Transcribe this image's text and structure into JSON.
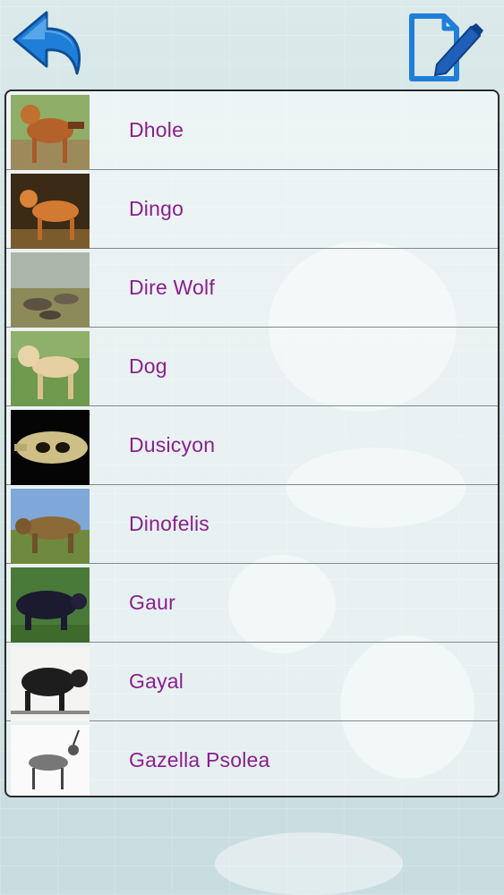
{
  "header": {
    "back_icon": "back-arrow-icon",
    "note_icon": "edit-note-icon",
    "accent_color": "#1f7fd8"
  },
  "list": {
    "text_color": "#8a1f8f",
    "items": [
      {
        "label": "Dhole",
        "image": "dhole-photo"
      },
      {
        "label": "Dingo",
        "image": "dingo-photo"
      },
      {
        "label": "Dire Wolf",
        "image": "dire-wolf-illustration"
      },
      {
        "label": "Dog",
        "image": "dog-photo"
      },
      {
        "label": "Dusicyon",
        "image": "dusicyon-skull-photo"
      },
      {
        "label": "Dinofelis",
        "image": "dinofelis-illustration"
      },
      {
        "label": "Gaur",
        "image": "gaur-photo"
      },
      {
        "label": "Gayal",
        "image": "gayal-engraving"
      },
      {
        "label": "Gazella Psolea",
        "image": "gazella-sketch"
      }
    ]
  }
}
